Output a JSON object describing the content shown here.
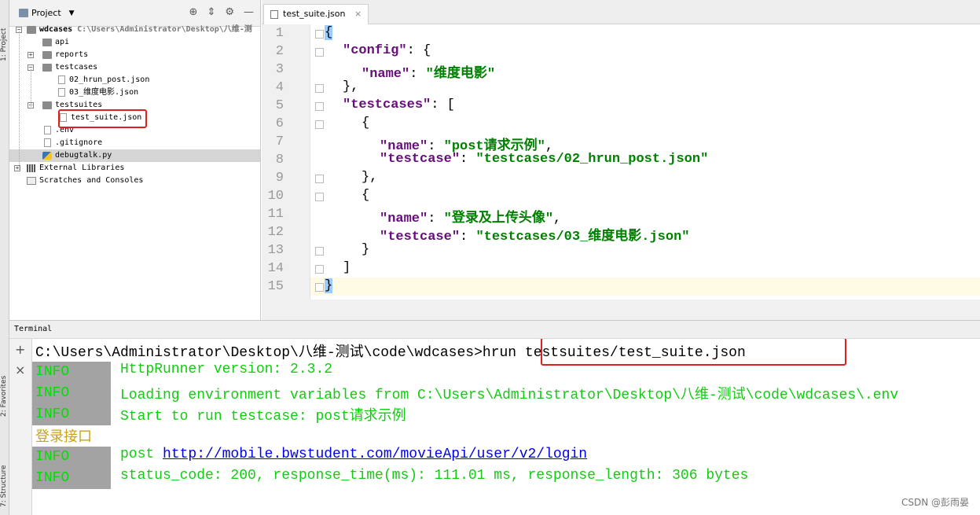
{
  "side_tabs": {
    "project": "1: Project",
    "favorites": "2: Favorites",
    "structure": "7: Structure"
  },
  "project": {
    "title": "Project",
    "tree": [
      {
        "label": "wdcases",
        "path": "C:\\Users\\Administrator\\Desktop\\八维-测",
        "type": "folder",
        "depth": 0,
        "bold": true
      },
      {
        "label": "api",
        "type": "folder",
        "depth": 1
      },
      {
        "label": "reports",
        "type": "folder",
        "depth": 1
      },
      {
        "label": "testcases",
        "type": "folder",
        "depth": 1
      },
      {
        "label": "02_hrun_post.json",
        "type": "file",
        "depth": 2
      },
      {
        "label": "03_维度电影.json",
        "type": "file",
        "depth": 2
      },
      {
        "label": "testsuites",
        "type": "folder",
        "depth": 1
      },
      {
        "label": "test_suite.json",
        "type": "file",
        "depth": 2,
        "highlighted": true
      },
      {
        "label": ".env",
        "type": "file",
        "depth": 1
      },
      {
        "label": ".gitignore",
        "type": "file",
        "depth": 1
      },
      {
        "label": "debugtalk.py",
        "type": "file",
        "depth": 1,
        "selected": true
      },
      {
        "label": "External Libraries",
        "type": "lib",
        "depth": 0
      },
      {
        "label": "Scratches and Consoles",
        "type": "scratch",
        "depth": 0
      }
    ]
  },
  "editor": {
    "tab_label": "test_suite.json",
    "line_numbers": [
      "1",
      "2",
      "3",
      "4",
      "5",
      "6",
      "7",
      "8",
      "9",
      "10",
      "11",
      "12",
      "13",
      "14",
      "15"
    ],
    "code": {
      "l1": "{",
      "l2_key": "\"config\"",
      "l2_rest": ": {",
      "l3_key": "\"name\"",
      "l3_sep": ": ",
      "l3_val": "\"维度电影\"",
      "l4": "},",
      "l5_key": "\"testcases\"",
      "l5_rest": ": [",
      "l6": "{",
      "l7_key": "\"name\"",
      "l7_sep": ": ",
      "l7_val": "\"post请求示例\"",
      "l7_end": ",",
      "l8_key": "\"testcase\"",
      "l8_sep": ": ",
      "l8_val": "\"testcases/02_hrun_post.json\"",
      "l9": "},",
      "l10": "{",
      "l11_key": "\"name\"",
      "l11_sep": ": ",
      "l11_val": "\"登录及上传头像\"",
      "l11_end": ",",
      "l12_key": "\"testcase\"",
      "l12_sep": ": ",
      "l12_val": "\"testcases/03_维度电影.json\"",
      "l13": "}",
      "l14": "]",
      "l15": "}"
    }
  },
  "terminal": {
    "title": "Terminal",
    "prompt": "C:\\Users\\Administrator\\Desktop\\八维-测试\\code\\wdcases>",
    "command": "hrun testsuites/test_suite.json",
    "lines": [
      {
        "level": "INFO",
        "msg": "HttpRunner version: 2.3.2"
      },
      {
        "level": "INFO",
        "msg": "Loading environment variables from C:\\Users\\Administrator\\Desktop\\八维-测试\\code\\wdcases\\.env"
      },
      {
        "level": "INFO",
        "msg": "Start to run testcase: post请求示例"
      }
    ],
    "plain_line": "登录接口",
    "post_level": "INFO",
    "post_prefix": "post ",
    "post_url": "http://mobile.bwstudent.com/movieApi/user/v2/login",
    "status_level": "INFO",
    "status_msg": "status_code: 200, response_time(ms): 111.01 ms, response_length: 306 bytes"
  },
  "watermark": "CSDN @彭雨晏",
  "colors": {
    "highlight_box": "#e02020",
    "info_text": "#00e000",
    "key": "#660e7a",
    "string": "#008000"
  }
}
